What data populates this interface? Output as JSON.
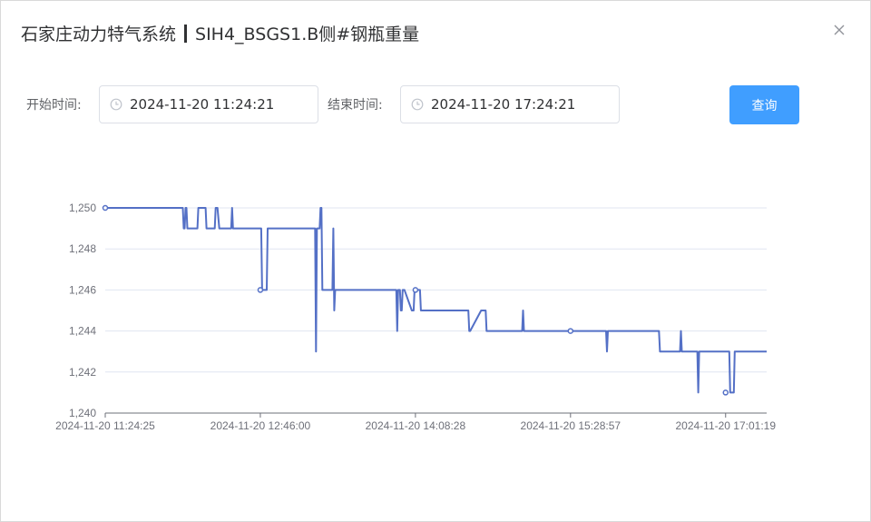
{
  "dialog": {
    "title_left": "石家庄动力特气系统",
    "title_right": "SIH4_BSGS1.B侧#钢瓶重量",
    "close_icon": "close-icon"
  },
  "filters": {
    "start_label": "开始时间:",
    "start_value": "2024-11-20 11:24:21",
    "end_label": "结束时间:",
    "end_value": "2024-11-20 17:24:21",
    "clock_icon": "clock-icon",
    "query_label": "查询"
  },
  "colors": {
    "line": "#5470c6",
    "button": "#409eff",
    "grid": "#e0e6f1"
  },
  "chart_data": {
    "type": "line",
    "xlabel": "",
    "ylabel": "",
    "ylim": [
      1240,
      1250
    ],
    "yticks": [
      "1,240",
      "1,242",
      "1,244",
      "1,246",
      "1,248",
      "1,250"
    ],
    "xticks": [
      "2024-11-20 11:24:25",
      "2024-11-20 12:46:00",
      "2024-11-20 14:08:28",
      "2024-11-20 15:28:57",
      "2024-11-20 17:01:19"
    ],
    "x_index": [
      0,
      85,
      86,
      87,
      88,
      89,
      90,
      91,
      92,
      93,
      95,
      96,
      100,
      101,
      102,
      103,
      105,
      106,
      110,
      111,
      112,
      113,
      120,
      121,
      122,
      123,
      125,
      126,
      127,
      128,
      130,
      131,
      132,
      133,
      135,
      136,
      138,
      139,
      140,
      141,
      160,
      162,
      163,
      164,
      165,
      170,
      171,
      172,
      173,
      174,
      175,
      176,
      177,
      178,
      200,
      220,
      221,
      222,
      223,
      224,
      225,
      226,
      227,
      230,
      231,
      232,
      233,
      234,
      235,
      236,
      237,
      238,
      239,
      240,
      248,
      249,
      250,
      251,
      252,
      253,
      254,
      255,
      300,
      310,
      311,
      312,
      313,
      314,
      318,
      319,
      320,
      321,
      322,
      323,
      324,
      325,
      326,
      327,
      328,
      336,
      337,
      338,
      339,
      340,
      341,
      342,
      343,
      344,
      345,
      346,
      347,
      350,
      380,
      393,
      394,
      395,
      396,
      397,
      398,
      399,
      400,
      412,
      413,
      414,
      415,
      416,
      417,
      418,
      455,
      456,
      457,
      458,
      459,
      460,
      500,
      509,
      510,
      511,
      512,
      513,
      518,
      519,
      520,
      521,
      522,
      523,
      524,
      525,
      526,
      530,
      540,
      548,
      549,
      550,
      551,
      552,
      553,
      575,
      576,
      577,
      578,
      579,
      580,
      606,
      607,
      608,
      609,
      610,
      611,
      630,
      631,
      632,
      633,
      640,
      641,
      642,
      643,
      644,
      645,
      646,
      647,
      648,
      649,
      650,
      651,
      674,
      675,
      676,
      677,
      678,
      679,
      680,
      681,
      682,
      683,
      684,
      685,
      686,
      687,
      688,
      689,
      690,
      694,
      695,
      696,
      697,
      698,
      699,
      700,
      701,
      702,
      703,
      704,
      705,
      706,
      707,
      708,
      709,
      710,
      711,
      712,
      720,
      721,
      722,
      723,
      724,
      725
    ],
    "series": [
      {
        "values": [
          1250,
          1250,
          1249,
          1249,
          1250,
          1250,
          1249,
          1249,
          1249,
          1249,
          1249,
          1249,
          1249,
          1249,
          1250,
          1250,
          1250,
          1250,
          1250,
          1249,
          1249,
          1249,
          1249,
          1250,
          1250,
          1250,
          1249,
          1249,
          1249,
          1249,
          1249,
          1249,
          1249,
          1249,
          1249,
          1249,
          1249,
          1250,
          1249,
          1249,
          1249,
          1249,
          1249,
          1249,
          1249,
          1249,
          1249,
          1246,
          1246,
          1246,
          1246,
          1246,
          1246,
          1249,
          1249,
          1249,
          1249,
          1249,
          1249,
          1249,
          1249,
          1249,
          1249,
          1249,
          1243,
          1249,
          1249,
          1249,
          1249,
          1250,
          1250,
          1246,
          1246,
          1246,
          1246,
          1246,
          1249,
          1245,
          1246,
          1246,
          1246,
          1246,
          1246,
          1246,
          1246,
          1246,
          1246,
          1246,
          1246,
          1246,
          1244,
          1246,
          1246,
          1246,
          1245,
          1245,
          1246,
          1246,
          1246,
          1245,
          1245,
          1245,
          1246,
          1246,
          1246,
          1246,
          1246,
          1246,
          1246,
          1245,
          1245,
          1245,
          1245,
          1245,
          1245,
          1245,
          1245,
          1245,
          1245,
          1244,
          1244,
          1245,
          1245,
          1245,
          1245,
          1245,
          1245,
          1244,
          1244,
          1244,
          1244,
          1245,
          1244,
          1244,
          1244,
          1244,
          1244,
          1244,
          1244,
          1244,
          1244,
          1244,
          1244,
          1244,
          1244,
          1244,
          1244,
          1244,
          1244,
          1244,
          1244,
          1244,
          1244,
          1243,
          1244,
          1244,
          1244,
          1244,
          1244,
          1244,
          1244,
          1244,
          1244,
          1244,
          1244,
          1243,
          1243,
          1243,
          1243,
          1243,
          1244,
          1243,
          1243,
          1243,
          1243,
          1243,
          1243,
          1243,
          1243,
          1243,
          1243,
          1243,
          1243,
          1241,
          1243,
          1243,
          1243,
          1243,
          1243,
          1243,
          1243,
          1243,
          1243,
          1243,
          1243,
          1243,
          1241,
          1241,
          1241,
          1241,
          1241,
          1243,
          1243,
          1243,
          1243,
          1243,
          1243,
          1243,
          1243,
          1243,
          1243,
          1243,
          1243,
          1243,
          1243,
          1243,
          1243,
          1243,
          1243,
          1243,
          1243,
          1243,
          1243,
          1243,
          1243,
          1243,
          1243,
          1243,
          1243,
          1243
        ]
      }
    ],
    "markers": [
      {
        "i": 0,
        "y": 1250
      },
      {
        "i": 170,
        "y": 1246
      },
      {
        "i": 340,
        "y": 1246
      },
      {
        "i": 510,
        "y": 1244
      },
      {
        "i": 680,
        "y": 1241
      }
    ],
    "grid": true
  }
}
